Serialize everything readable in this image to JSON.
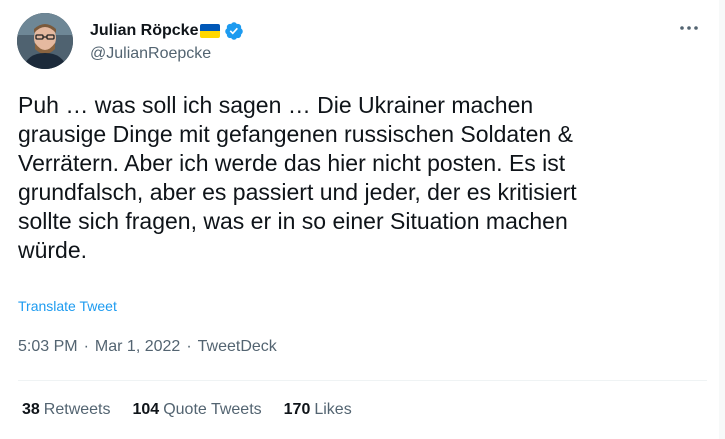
{
  "author": {
    "name": "Julian Röpcke",
    "handle": "@JulianRoepcke",
    "flag_colors": [
      "#0057b7",
      "#ffd700"
    ],
    "verified_color": "#1d9bf0"
  },
  "tweet": {
    "text": "Puh … was soll ich sagen … Die Ukrainer machen\ngrausige Dinge mit gefangenen russischen Soldaten &\nVerrätern. Aber ich werde das hier nicht posten. Es ist\ngrundfalsch, aber es passiert und jeder, der es kritisiert\nsollte sich fragen, was er in so einer Situation machen\nwürde.",
    "translate_label": "Translate Tweet",
    "time": "5:03 PM",
    "separator": "·",
    "date": "Mar 1, 2022",
    "source": "TweetDeck"
  },
  "stats": {
    "retweets_count": "38",
    "retweets_label": "Retweets",
    "quotes_count": "104",
    "quotes_label": "Quote Tweets",
    "likes_count": "170",
    "likes_label": "Likes"
  },
  "icons": {
    "more": "more-horizontal-icon",
    "verified": "verified-badge-icon",
    "flag": "ukraine-flag-icon"
  }
}
